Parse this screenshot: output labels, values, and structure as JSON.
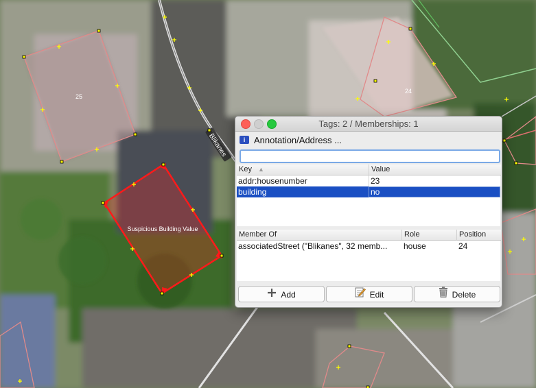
{
  "map": {
    "road_label": "Blikanes",
    "building_labels": [
      "25",
      "24"
    ],
    "selected_building_label": "Suspicious Building Value"
  },
  "dialog": {
    "title": "Tags: 2 / Memberships: 1",
    "preset": "Annotation/Address ...",
    "search": {
      "value": "",
      "placeholder": ""
    },
    "tags": {
      "headers": {
        "key": "Key",
        "value": "Value"
      },
      "rows": [
        {
          "key": "addr:housenumber",
          "value": "23"
        },
        {
          "key": "building",
          "value": "no"
        }
      ]
    },
    "memberships": {
      "headers": {
        "member_of": "Member Of",
        "role": "Role",
        "position": "Position"
      },
      "rows": [
        {
          "member_of": "associatedStreet (\"Blikanes\", 32 memb...",
          "role": "house",
          "position": "24"
        }
      ]
    },
    "buttons": {
      "add": "Add",
      "edit": "Edit",
      "delete": "Delete"
    }
  },
  "colors": {
    "selection": "#1a4fc3",
    "selected_building": "#ff1a1a",
    "building_outline": "#e08a8a",
    "node": "#ffff00"
  }
}
